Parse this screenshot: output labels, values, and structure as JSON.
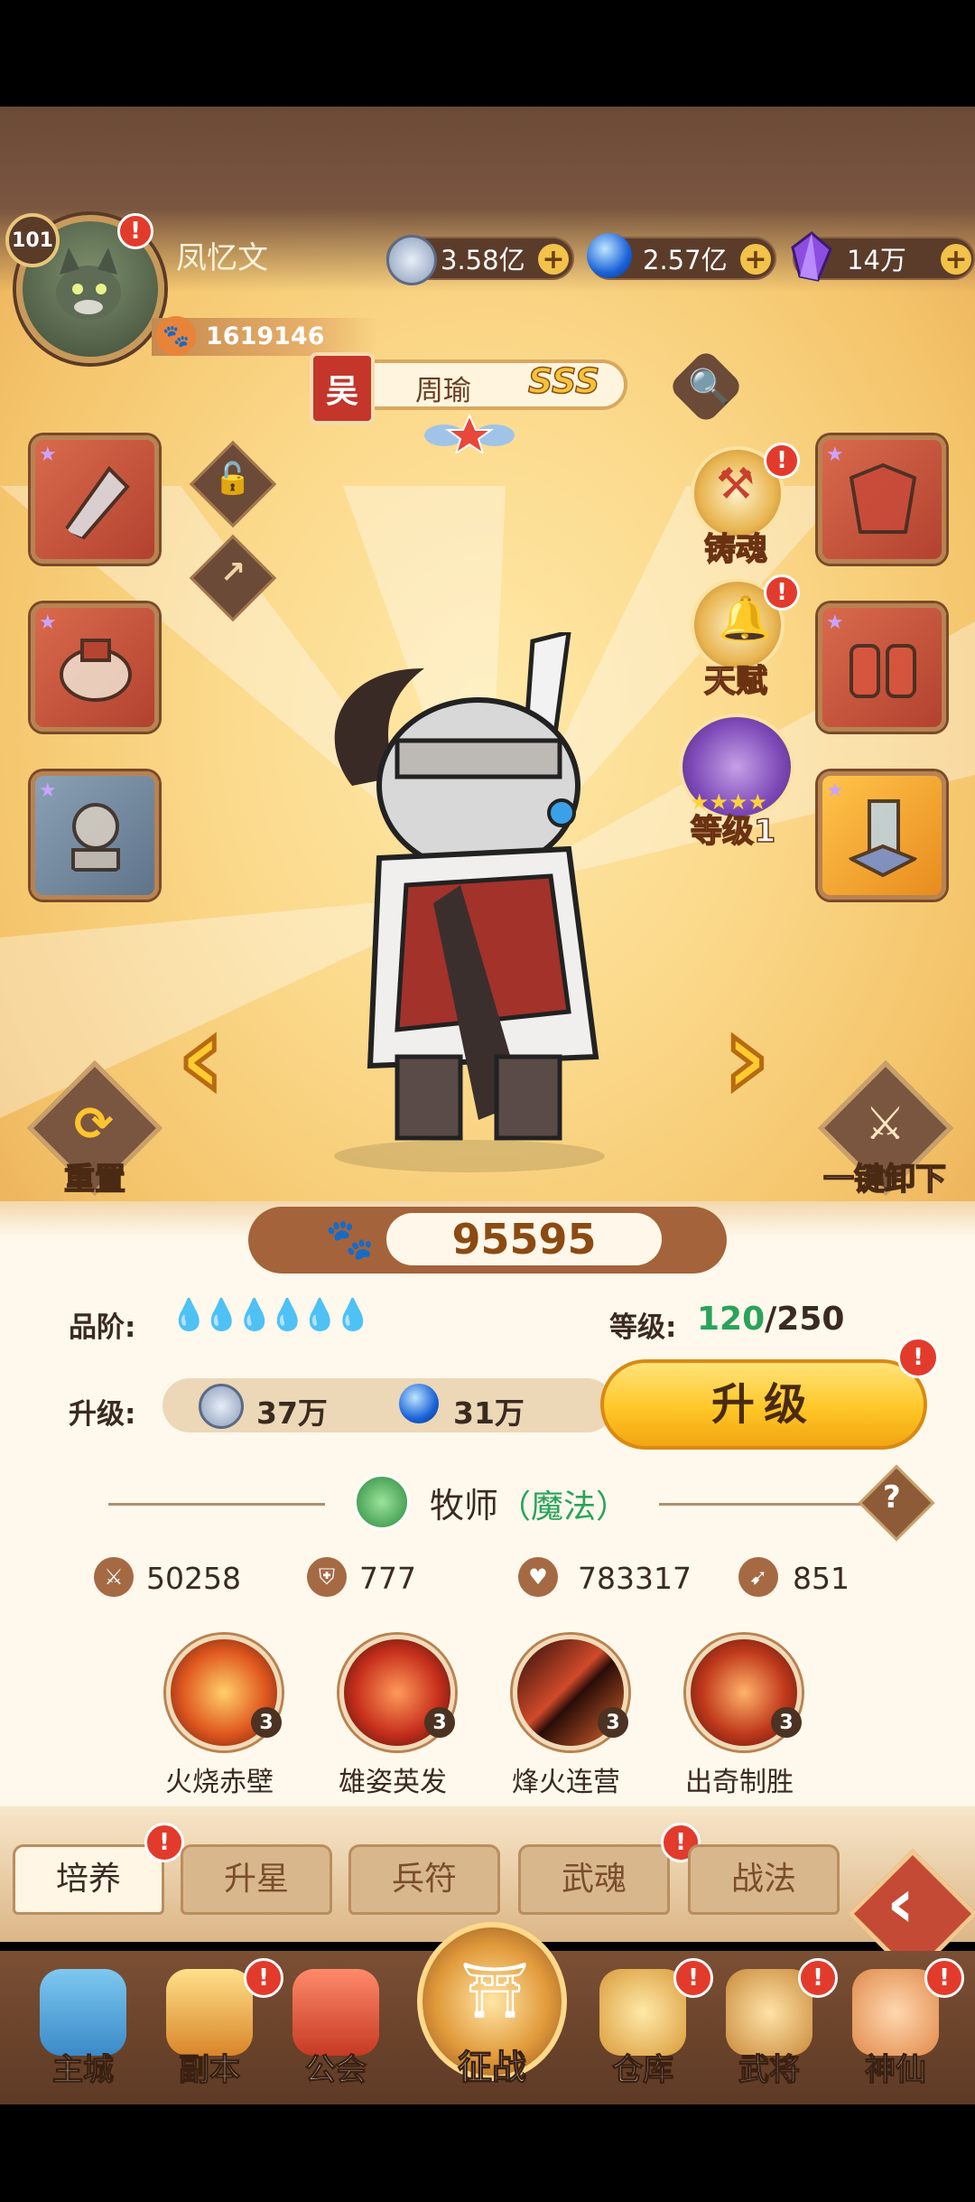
{
  "player": {
    "level": "101",
    "name": "凤忆文",
    "power": "1619146",
    "alert": "!"
  },
  "resources": [
    {
      "icon": "silver-coin-icon",
      "value": "3.58亿"
    },
    {
      "icon": "blue-orb-icon",
      "value": "2.57亿"
    },
    {
      "icon": "purple-gem-icon",
      "value": "14万"
    }
  ],
  "hero": {
    "faction": "吴",
    "name": "周瑜",
    "grade": "SSS"
  },
  "features": {
    "soul": "铸魂",
    "talent": "天赋",
    "level": "等级1"
  },
  "side_buttons": {
    "reset": "重置",
    "unequip_all": "一键卸下"
  },
  "combat_power": "95595",
  "rank": {
    "label": "品阶:",
    "drops": "💧💧💧💧💧💧"
  },
  "level": {
    "label": "等级:",
    "current": "120",
    "max": "/250"
  },
  "upgrade": {
    "label": "升级:",
    "cost1": "37万",
    "cost2": "31万",
    "button": "升级"
  },
  "class": {
    "name": "牧师",
    "open": "（",
    "type": "魔法",
    "close": "）",
    "help": "?"
  },
  "stats": [
    {
      "icon": "sword-icon",
      "value": "50258"
    },
    {
      "icon": "shield-icon",
      "value": "777"
    },
    {
      "icon": "heart-icon",
      "value": "783317"
    },
    {
      "icon": "boot-icon",
      "value": "851"
    }
  ],
  "skills": [
    {
      "name": "火烧赤壁",
      "level": "3"
    },
    {
      "name": "雄姿英发",
      "level": "3"
    },
    {
      "name": "烽火连营",
      "level": "3"
    },
    {
      "name": "出奇制胜",
      "level": "3"
    }
  ],
  "tabs": [
    "培养",
    "升星",
    "兵符",
    "武魂",
    "战法"
  ],
  "nav": {
    "city": "主城",
    "dungeon": "副本",
    "guild": "公会",
    "conquer": "征战",
    "warehouse": "仓库",
    "generals": "武将",
    "immortal": "神仙"
  },
  "colors": {
    "accent": "#ffc727",
    "alert": "#e23b2c",
    "class_type": "#2aa35a",
    "level_current": "#2aa35a",
    "brown": "#6b4a37"
  }
}
